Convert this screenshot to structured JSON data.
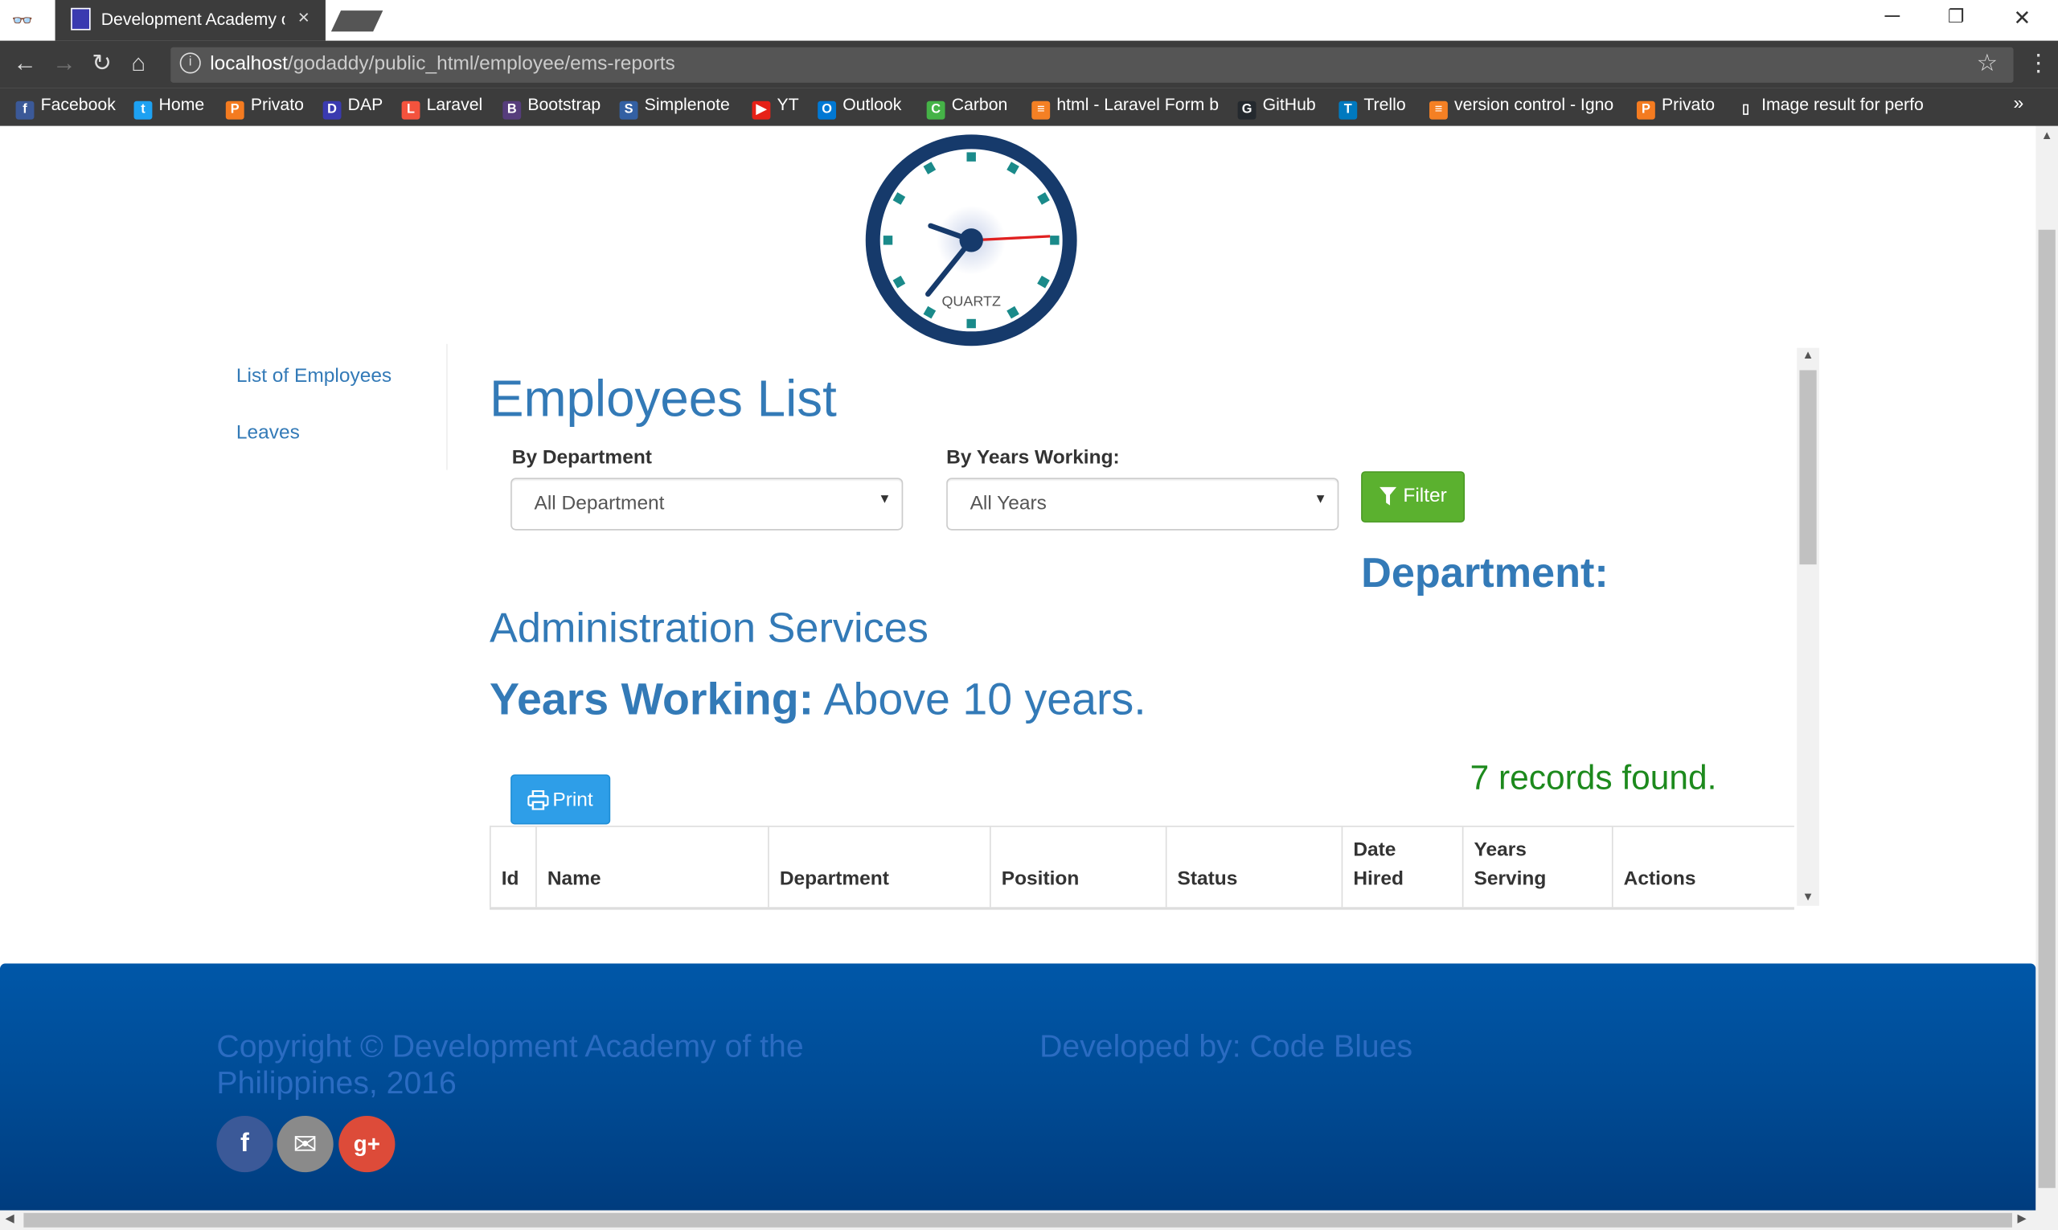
{
  "browser": {
    "tab_title": "Development Academy of",
    "tab_close": "×",
    "window_controls": {
      "minimize": "─",
      "restore": "❐",
      "close": "✕"
    },
    "url_host": "localhost",
    "url_path": "/godaddy/public_html/employee/ems-reports",
    "bookmarks": [
      {
        "label": "Facebook",
        "color": "#3b5998",
        "glyph": "f"
      },
      {
        "label": "Home",
        "color": "#1da1f2",
        "glyph": "t"
      },
      {
        "label": "Privato",
        "color": "#f47b20",
        "glyph": "P"
      },
      {
        "label": "DAP",
        "color": "#3a3ab0",
        "glyph": "D"
      },
      {
        "label": "Laravel",
        "color": "#f4533d",
        "glyph": "L"
      },
      {
        "label": "Bootstrap",
        "color": "#563d7c",
        "glyph": "B"
      },
      {
        "label": "Simplenote",
        "color": "#3360a3",
        "glyph": "S"
      },
      {
        "label": "YT",
        "color": "#e62117",
        "glyph": "▶"
      },
      {
        "label": "Outlook",
        "color": "#0078d4",
        "glyph": "O"
      },
      {
        "label": "Carbon",
        "color": "#45b347",
        "glyph": "C"
      },
      {
        "label": "html - Laravel Form b",
        "color": "#f48024",
        "glyph": "≡"
      },
      {
        "label": "GitHub",
        "color": "#24292e",
        "glyph": "G"
      },
      {
        "label": "Trello",
        "color": "#0079bf",
        "glyph": "T"
      },
      {
        "label": "version control - Igno",
        "color": "#f48024",
        "glyph": "≡"
      },
      {
        "label": "Privato",
        "color": "#f47b20",
        "glyph": "P"
      },
      {
        "label": "Image result for perfo",
        "color": "#3c3c3c",
        "glyph": "▯"
      }
    ],
    "bookmarks_more": "»"
  },
  "clock": {
    "brand": "QUARTZ",
    "ring_color": "#1a3d6e",
    "marker_color": "#1a8a8a"
  },
  "sidebar": {
    "items": [
      {
        "label": "List of Employees"
      },
      {
        "label": "Leaves"
      }
    ]
  },
  "main": {
    "title": "Employees List",
    "filters": {
      "department_label": "By Department",
      "department_value": "All Department",
      "years_label": "By Years Working:",
      "years_value": "All Years",
      "filter_button": "Filter"
    },
    "department_heading": "Department:",
    "department_value": "Administration Services",
    "years_heading": "Years Working:",
    "years_value": "Above 10 years.",
    "print_button": "Print",
    "records_found": "7 records found.",
    "table_columns": [
      "Id",
      "Name",
      "Department",
      "Position",
      "Status",
      "Date Hired",
      "Years Serving",
      "Actions"
    ]
  },
  "footer": {
    "copyright": "Copyright © Development Academy of the Philippines, 2016",
    "developed_by": "Developed by: Code Blues",
    "social": [
      {
        "name": "facebook",
        "glyph": "f",
        "color": "#3b5998"
      },
      {
        "name": "email",
        "glyph": "✉",
        "color": "#8a8a8a"
      },
      {
        "name": "google-plus",
        "glyph": "g+",
        "color": "#dd4b39"
      }
    ]
  },
  "colors": {
    "link": "#337ab7",
    "success_text": "#1d8a1d",
    "filter_button": "#5bb12f",
    "print_button": "#2e9ee8",
    "footer_bg": "#004a93"
  }
}
